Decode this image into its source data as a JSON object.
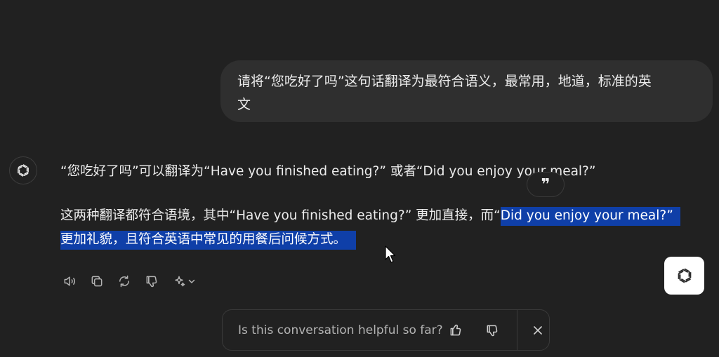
{
  "user_message": {
    "line1": "请将“您吃好了吗”这句话翻译为最符合语义，最常用，地道，标准的英",
    "line2": "文"
  },
  "assistant_message": {
    "line1": "“您吃好了吗”可以翻译为“Have you finished eating?” 或者“Did you enjoy your meal?”",
    "line2_plain": "这两种翻译都符合语境，其中“Have you finished eating?” 更加直接，而“",
    "line2_highlight": "Did you enjoy your meal?”",
    "line3_highlight": "更加礼貌，且符合英语中常见的用餐后问候方式。"
  },
  "quote_tooltip": {
    "label": "❞",
    "icon": "quote-icon"
  },
  "actions": {
    "icons": [
      "read-aloud-icon",
      "copy-icon",
      "regenerate-icon",
      "thumbs-down-icon",
      "model-switch-icon"
    ]
  },
  "feedback": {
    "question": "Is this conversation helpful so far?",
    "icons": [
      "thumbs-up-icon",
      "thumbs-down-icon",
      "close-icon"
    ]
  },
  "colors": {
    "background": "#212121",
    "user_bubble": "#2f2f2f",
    "highlight": "#0f3fa8",
    "text": "#ececec"
  }
}
